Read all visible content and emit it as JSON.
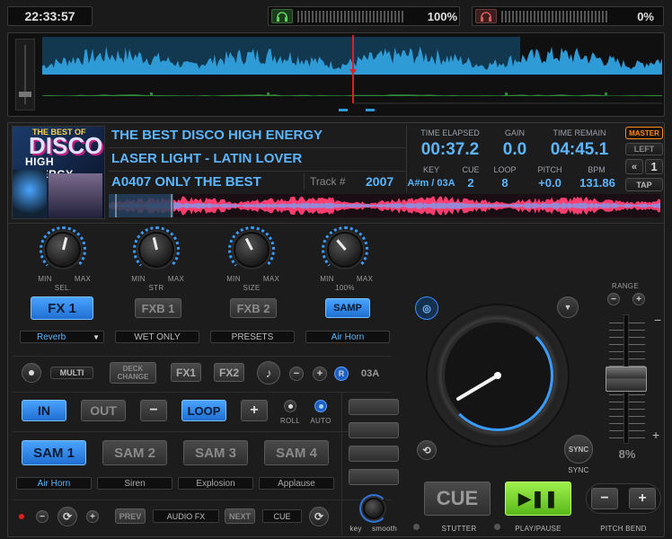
{
  "top_bar": {
    "clock": "22:33:57",
    "left_volume": "100%",
    "right_volume": "0%"
  },
  "track": {
    "title": "THE BEST DISCO HIGH ENERGY",
    "artist": "LASER LIGHT - LATIN LOVER",
    "album": "A0407 ONLY THE BEST",
    "track_label": "Track #",
    "track_number": "2007",
    "cover_text_top": "THE BEST OF",
    "cover_text_mid": "DISCO",
    "cover_text_bottom": "HIGH ENERGY"
  },
  "info": {
    "time_elapsed_label": "TIME ELAPSED",
    "time_elapsed": "00:37.2",
    "gain_label": "GAIN",
    "gain": "0.0",
    "time_remain_label": "TIME REMAIN",
    "time_remain": "04:45.1",
    "key_label": "KEY",
    "key": "A#m / 03A",
    "cue_label": "CUE",
    "cue": "2",
    "loop_label": "LOOP",
    "loop": "8",
    "pitch_label": "PITCH",
    "pitch": "+0.0",
    "bpm_label": "BPM",
    "bpm": "131.86"
  },
  "deck_side": {
    "master": "MASTER",
    "left": "LEFT",
    "deck_num": "1",
    "tap": "TAP"
  },
  "knobs": [
    {
      "name": "SEL.",
      "min": "MIN",
      "max": "MAX",
      "level": 0.55
    },
    {
      "name": "STR",
      "min": "MIN",
      "max": "MAX",
      "level": 0.45
    },
    {
      "name": "SIZE",
      "min": "MIN",
      "max": "MAX",
      "level": 0.4
    },
    {
      "name": "100%",
      "min": "MIN",
      "max": "MAX",
      "level": 0.35
    }
  ],
  "fx": {
    "fx1": "FX 1",
    "fxb1": "FXB 1",
    "fxb2": "FXB 2",
    "samp": "SAMP",
    "fx1_select": "Reverb",
    "fxb1_select": "WET ONLY",
    "fxb2_select": "PRESETS",
    "samp_select": "Air Horn"
  },
  "mid_row": {
    "multi": "MULTI",
    "deck_change": "DECK CHANGE",
    "fx1": "FX1",
    "fx2": "FX2",
    "minus": "−",
    "plus": "+",
    "r": "R",
    "key": "03A"
  },
  "loop_row": {
    "in": "IN",
    "out": "OUT",
    "minus": "−",
    "loop": "LOOP",
    "plus": "+",
    "roll": "ROLL",
    "auto": "AUTO"
  },
  "samplers": [
    {
      "label": "SAM 1",
      "sound": "Air Horn"
    },
    {
      "label": "SAM 2",
      "sound": "Siren"
    },
    {
      "label": "SAM 3",
      "sound": "Explosion"
    },
    {
      "label": "SAM 4",
      "sound": "Applause"
    }
  ],
  "bottom_row": {
    "prev": "PREV",
    "audio_fx": "AUDIO FX",
    "next": "NEXT",
    "cue": "CUE"
  },
  "key_knob": {
    "key": "key",
    "smooth": "smooth"
  },
  "transport": {
    "cue": "CUE",
    "stutter": "STUTTER",
    "play_pause": "PLAY/PAUSE",
    "sync": "SYNC",
    "sync_label": "SYNC",
    "pitch_bend": "PITCH BEND",
    "minus": "−",
    "plus": "+"
  },
  "pitch": {
    "range": "RANGE",
    "percent": "8%",
    "minus": "−",
    "plus": "+",
    "slider_minus": "−",
    "slider_plus": "+"
  },
  "colors": {
    "accent": "#3a9cff",
    "play": "#7ee02a",
    "waveform": "#2f9bd6"
  },
  "icons": {
    "headphone": "headphone-icon",
    "platter": "jog-wheel-icon"
  }
}
